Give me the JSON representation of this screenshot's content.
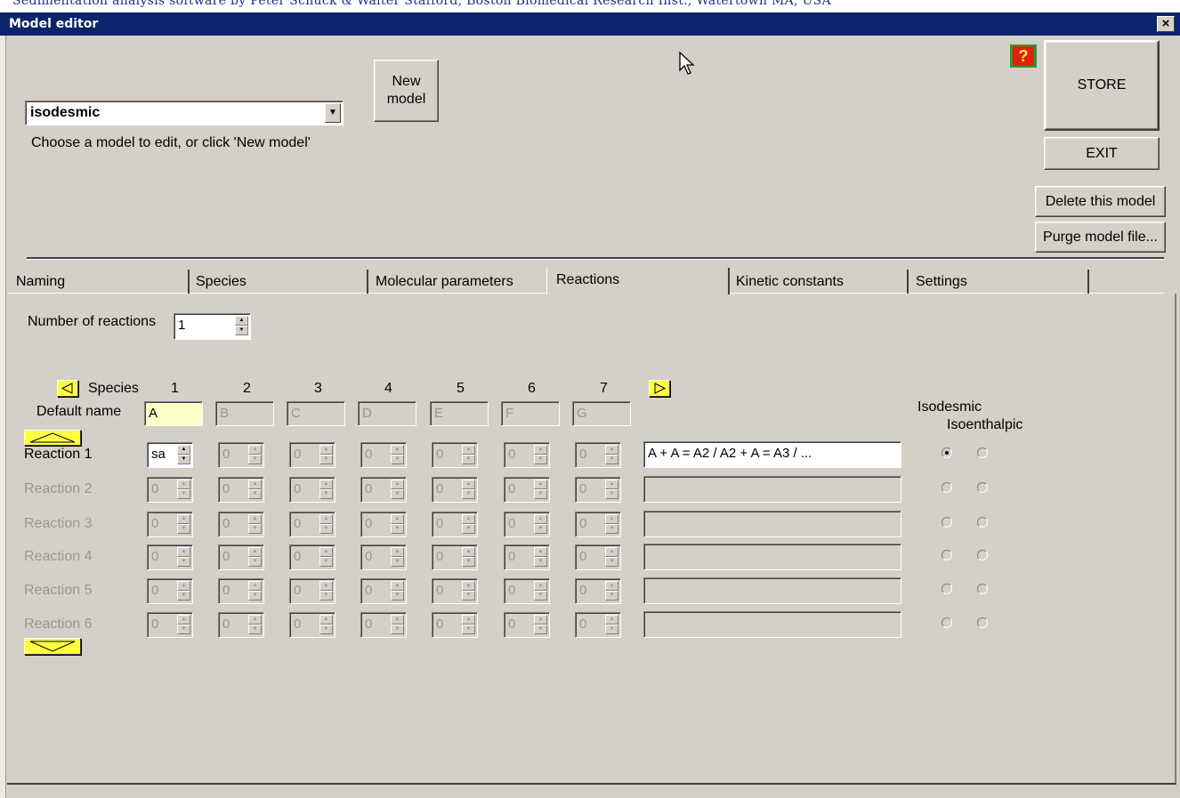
{
  "window": {
    "background_title": "Sedimentation analysis software by Peter Schuck & Walter Stafford, Boston Biomedical Research Inst., Watertown MA, USA",
    "title": "Model editor",
    "close_label": "×"
  },
  "top": {
    "model_select_value": "isodesmic",
    "model_hint": "Choose a model to edit, or click 'New model'",
    "new_model_label": "New\nmodel",
    "help_label": "?",
    "store_label": "STORE",
    "exit_label": "EXIT",
    "delete_label": "Delete this model",
    "purge_label": "Purge model file..."
  },
  "tabs": [
    {
      "label": "Naming",
      "active": false
    },
    {
      "label": "Species",
      "active": false
    },
    {
      "label": "Molecular parameters",
      "active": false
    },
    {
      "label": "Reactions",
      "active": true
    },
    {
      "label": "Kinetic constants",
      "active": false
    },
    {
      "label": "Settings",
      "active": false
    }
  ],
  "reactions_tab": {
    "num_reactions_label": "Number of reactions",
    "num_reactions_value": "1",
    "species_label": "Species",
    "species_numbers": [
      "1",
      "2",
      "3",
      "4",
      "5",
      "6",
      "7"
    ],
    "default_name_label": "Default name",
    "default_names": [
      "A",
      "B",
      "C",
      "D",
      "E",
      "F",
      "G"
    ],
    "isodesmic_label": "Isodesmic",
    "isoenthalpic_label": "Isoenthalpic",
    "rows": [
      {
        "label": "Reaction 1",
        "enabled": true,
        "coefficients": [
          "sa",
          "0",
          "0",
          "0",
          "0",
          "0",
          "0"
        ],
        "equation": "A + A = A2 / A2 + A = A3 / ...",
        "isodesmic": true,
        "isoenthalpic": false
      },
      {
        "label": "Reaction 2",
        "enabled": false,
        "coefficients": [
          "0",
          "0",
          "0",
          "0",
          "0",
          "0",
          "0"
        ],
        "equation": "",
        "isodesmic": false,
        "isoenthalpic": false
      },
      {
        "label": "Reaction 3",
        "enabled": false,
        "coefficients": [
          "0",
          "0",
          "0",
          "0",
          "0",
          "0",
          "0"
        ],
        "equation": "",
        "isodesmic": false,
        "isoenthalpic": false
      },
      {
        "label": "Reaction 4",
        "enabled": false,
        "coefficients": [
          "0",
          "0",
          "0",
          "0",
          "0",
          "0",
          "0"
        ],
        "equation": "",
        "isodesmic": false,
        "isoenthalpic": false
      },
      {
        "label": "Reaction 5",
        "enabled": false,
        "coefficients": [
          "0",
          "0",
          "0",
          "0",
          "0",
          "0",
          "0"
        ],
        "equation": "",
        "isodesmic": false,
        "isoenthalpic": false
      },
      {
        "label": "Reaction 6",
        "enabled": false,
        "coefficients": [
          "0",
          "0",
          "0",
          "0",
          "0",
          "0",
          "0"
        ],
        "equation": "",
        "isodesmic": false,
        "isoenthalpic": false
      }
    ]
  },
  "colors": {
    "title_bar": "#0b246b",
    "face": "#d4d0c8",
    "highlight_field": "#ffffc8",
    "nav_arrow": "#ffff40"
  },
  "icons": {
    "prev_species": "left-triangle-icon",
    "next_species": "right-triangle-icon",
    "scroll_up": "up-triangle-icon",
    "scroll_down": "down-triangle-icon"
  }
}
